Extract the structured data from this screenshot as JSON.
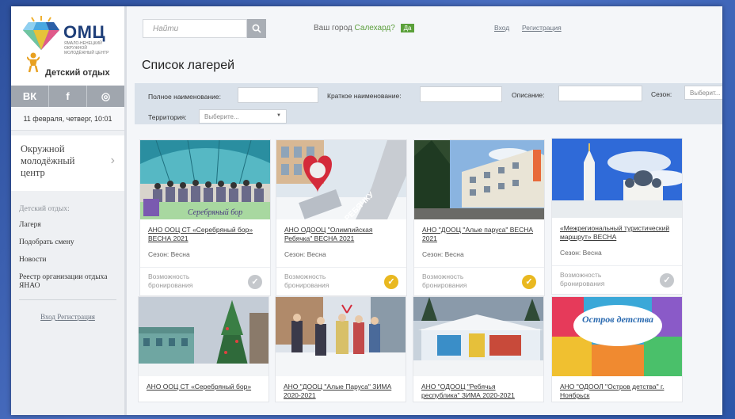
{
  "brand": {
    "name": "ОМЦ",
    "subtitle": "ЯМАЛО-НЕНЕЦКИЙ ОКРУЖНОЙ МОЛОДЁЖНЫЙ ЦЕНТР",
    "section": "Детский отдых"
  },
  "social": [
    {
      "icon": "vk-icon",
      "glyph": "ВК"
    },
    {
      "icon": "facebook-icon",
      "glyph": "f"
    },
    {
      "icon": "instagram-icon",
      "glyph": "◎"
    }
  ],
  "date_text": "11 февраля, четверг, 10:01",
  "center_link": {
    "label_line1": "Окружной",
    "label_line2": "молодёжный",
    "label_line3": "центр"
  },
  "menu": {
    "heading": "Детский отдых:",
    "items": [
      "Лагеря",
      "Подобрать смену",
      "Новости",
      "Реестр организации отдыха ЯНАО"
    ],
    "login": "Вход",
    "register": "Регистрация"
  },
  "header": {
    "search_placeholder": "Найти",
    "city_prefix": "Ваш город",
    "city_name": "Салехард?",
    "city_confirm": "Да",
    "login": "Вход",
    "register": "Регистрация"
  },
  "page_title": "Список лагерей",
  "filters": {
    "full_name_label": "Полное наименование:",
    "short_name_label": "Краткое наименование:",
    "description_label": "Описание:",
    "season_label": "Сезон:",
    "season_select": "Выберит...",
    "territory_label": "Территория:",
    "territory_select": "Выберите..."
  },
  "booking_label_1": "Возможность",
  "booking_label_2": "бронирования",
  "season_prefix": "Сезон:",
  "cards": [
    {
      "title": "АНО ООЦ СТ «Серебряный бор» ВЕСНА 2021",
      "season": "Весна",
      "booking": false
    },
    {
      "title": "АНО ОДООЦ \"Олимпийская Ребячка\" ВЕСНА 2021",
      "season": "Весна",
      "booking": true
    },
    {
      "title": "АНО \"ДООЦ \"Алые паруса\" ВЕСНА 2021",
      "season": "Весна",
      "booking": true
    },
    {
      "title": "«Межрегиональный туристический маршрут» ВЕСНА",
      "season": "Весна",
      "booking": false
    },
    {
      "title": "АНО ООЦ СТ «Серебряный бор»",
      "season": "",
      "booking": null
    },
    {
      "title": "АНО \"ДООЦ \"Алые Паруса\" ЗИМА 2020-2021",
      "season": "",
      "booking": null
    },
    {
      "title": "АНО \"ОДООЦ \"Ребячья республика\" ЗИМА 2020-2021",
      "season": "",
      "booking": null
    },
    {
      "title": "АНО \"ОДООЛ \"Остров детства\" г. Ноябрьск",
      "season": "",
      "booking": null
    }
  ],
  "image_texts": {
    "silver_bor": "Серебряный бор",
    "heart_sign": "Я РЕБЯЧКУ",
    "island": "Остров детства"
  },
  "colors": {
    "accent_green": "#5aa03a",
    "check_yellow": "#e9b820",
    "check_gray": "#c5c8cc",
    "filter_bg": "#d9e1ea"
  }
}
